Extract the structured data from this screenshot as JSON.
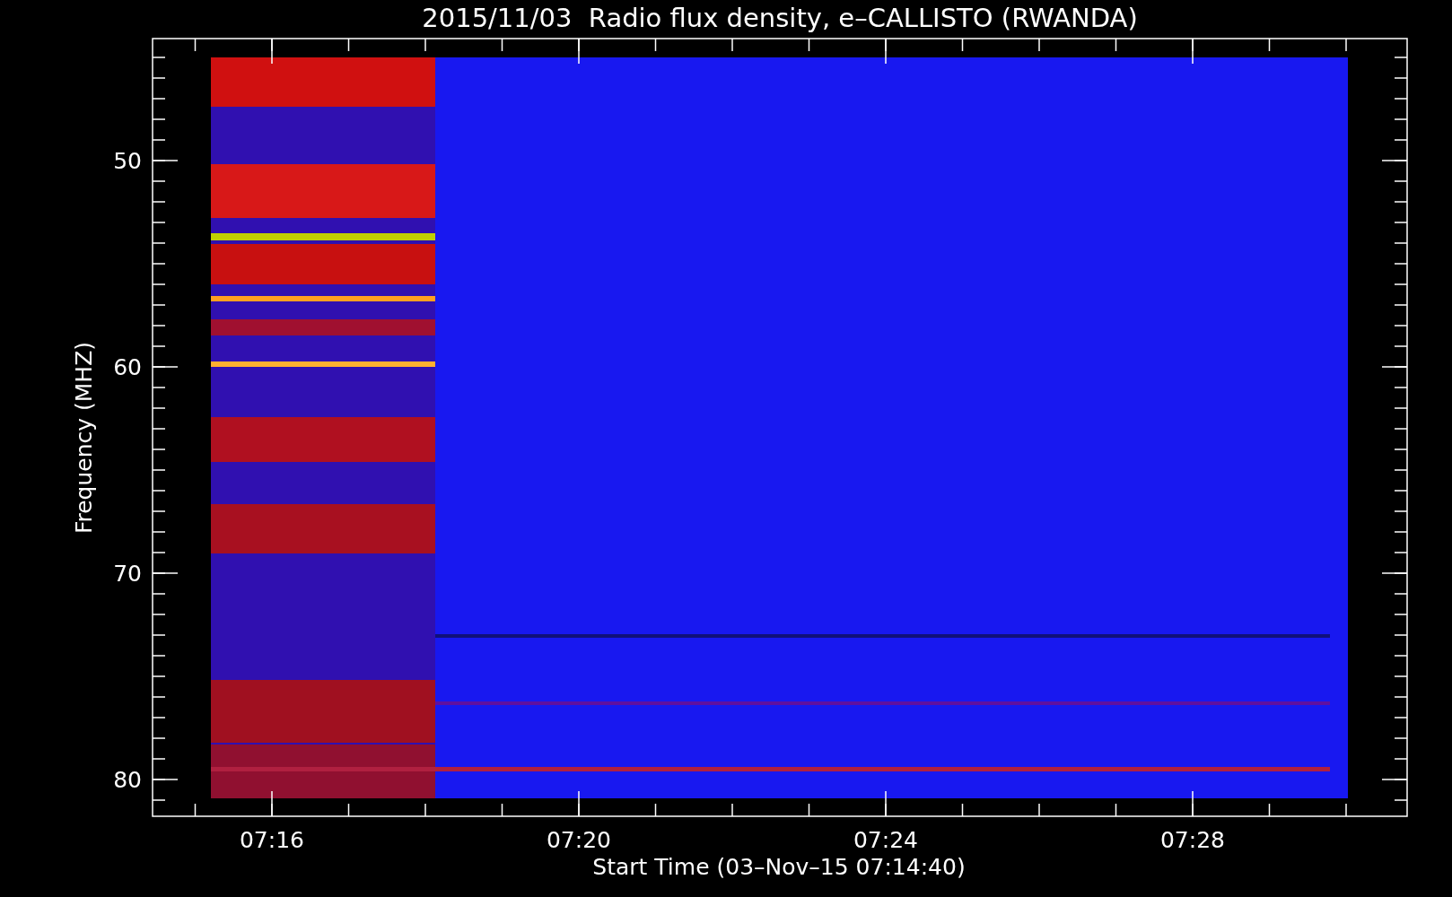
{
  "chart": {
    "title": "2015/11/03  Radio flux density, e–CALLISTO (RWANDA)",
    "xlabel": "Start Time (03–Nov–15 07:14:40)",
    "ylabel": "Frequency (MHZ)",
    "yticks": [
      "50",
      "60",
      "70",
      "80"
    ],
    "xticks": [
      "07:16",
      "07:20",
      "07:24",
      "07:28"
    ]
  }
}
